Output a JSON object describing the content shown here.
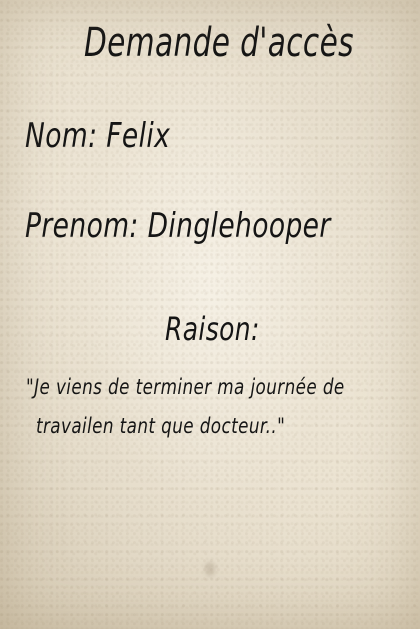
{
  "form": {
    "title": "Demande d'accès",
    "nom_label": "Nom:",
    "nom_value": "Felix",
    "prenom_label": "Prenom:",
    "prenom_value": "Dinglehooper",
    "raison_label": "Raison:",
    "raison_lines": [
      "\"Je viens de terminer ma  journée de",
      "travailen tant que docteur..\""
    ]
  }
}
